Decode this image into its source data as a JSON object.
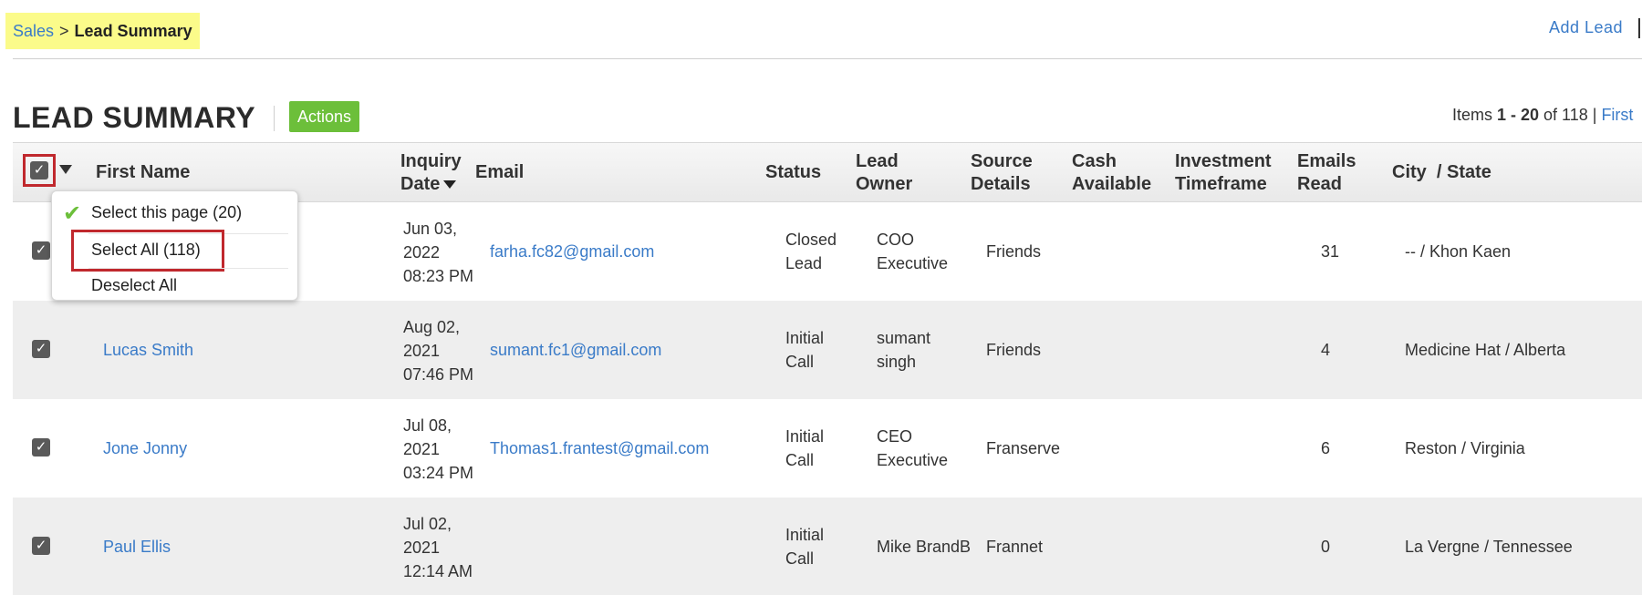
{
  "breadcrumb": {
    "parent": "Sales",
    "separator": ">",
    "current": "Lead Summary"
  },
  "header_links": {
    "add_lead": "Add  Lead"
  },
  "page": {
    "title": "LEAD SUMMARY",
    "actions_label": "Actions"
  },
  "pagination": {
    "prefix": "Items ",
    "range": "1 - 20",
    "of_text": " of 118 | ",
    "first": "First"
  },
  "columns": {
    "first_name": "First Name",
    "inquiry_date_1": "Inquiry",
    "inquiry_date_2": "Date",
    "email": "Email",
    "status": "Status",
    "lead_owner_1": "Lead",
    "lead_owner_2": "Owner",
    "source_1": "Source",
    "source_2": "Details",
    "cash_1": "Cash",
    "cash_2": "Available",
    "invest_1": "Investment",
    "invest_2": "Timeframe",
    "emails_1": "Emails",
    "emails_2": "Read",
    "city_state": "City  / State"
  },
  "select_menu": {
    "select_page": "Select this page (20)",
    "select_all": "Select All (118)",
    "deselect_all": "Deselect All"
  },
  "rows": [
    {
      "name": "",
      "date1": "Jun 03,",
      "date2": "2022",
      "date3": "08:23 PM",
      "email": "farha.fc82@gmail.com",
      "status1": "Closed",
      "status2": "Lead",
      "owner1": "COO",
      "owner2": "Executive",
      "source": "Friends",
      "emails_read": "31",
      "city_state": "-- / Khon Kaen"
    },
    {
      "name": "Lucas Smith",
      "date1": "Aug 02,",
      "date2": "2021",
      "date3": "07:46 PM",
      "email": "sumant.fc1@gmail.com",
      "status1": "Initial",
      "status2": "Call",
      "owner1": "sumant",
      "owner2": "singh",
      "source": "Friends",
      "emails_read": "4",
      "city_state": "Medicine Hat / Alberta"
    },
    {
      "name": "Jone Jonny",
      "date1": "Jul 08,",
      "date2": "2021",
      "date3": "03:24 PM",
      "email": "Thomas1.frantest@gmail.com",
      "status1": "Initial",
      "status2": "Call",
      "owner1": "CEO",
      "owner2": "Executive",
      "source": "Franserve",
      "emails_read": "6",
      "city_state": "Reston / Virginia"
    },
    {
      "name": "Paul Ellis",
      "date1": "Jul 02,",
      "date2": "2021",
      "date3": "12:14 AM",
      "email": "",
      "status1": "Initial",
      "status2": "Call",
      "owner1": "Mike BrandB",
      "owner2": "",
      "source": "Frannet",
      "emails_read": "0",
      "city_state": "La Vergne / Tennessee"
    }
  ],
  "icons": {
    "checkbox": "checkbox-checked-icon",
    "check": "green-check-icon",
    "caret": "caret-down-icon"
  },
  "colors": {
    "link": "#3a7bc8",
    "actions": "#6cbf3a",
    "highlight_box": "#c0282d",
    "breadcrumb_bg": "#fbfb8a"
  }
}
